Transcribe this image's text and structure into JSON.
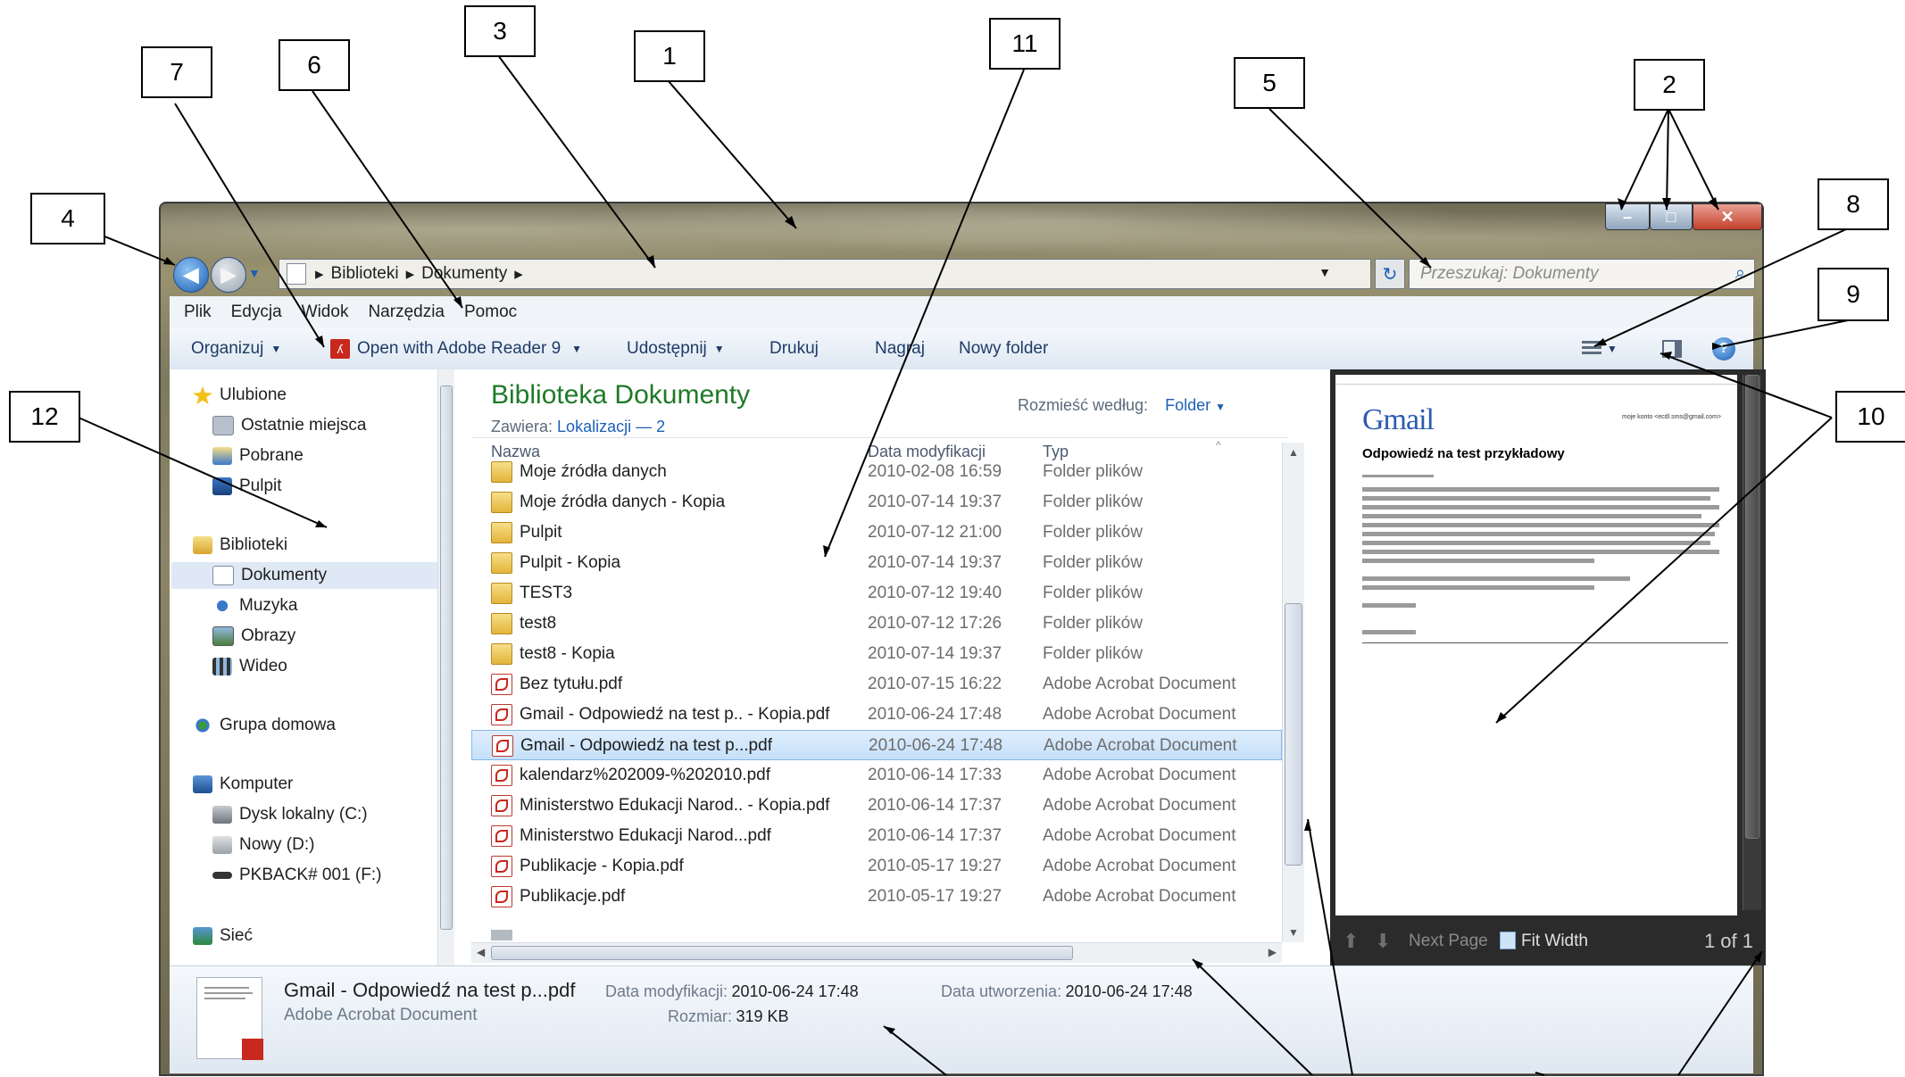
{
  "nav": {
    "breadcrumb": [
      "Biblioteki",
      "Dokumenty"
    ],
    "search_placeholder": "Przeszukaj: Dokumenty"
  },
  "menu": [
    "Plik",
    "Edycja",
    "Widok",
    "Narzędzia",
    "Pomoc"
  ],
  "toolbar": {
    "organize": "Organizuj",
    "open_with": "Open with Adobe Reader 9",
    "share": "Udostępnij",
    "print": "Drukuj",
    "burn": "Nagraj",
    "new_folder": "Nowy folder"
  },
  "sidebar": {
    "favorites": "Ulubione",
    "recent": "Ostatnie miejsca",
    "downloads": "Pobrane",
    "desktop": "Pulpit",
    "libraries": "Biblioteki",
    "documents": "Dokumenty",
    "music": "Muzyka",
    "pictures": "Obrazy",
    "video": "Wideo",
    "homegroup": "Grupa domowa",
    "computer": "Komputer",
    "drive_c": "Dysk lokalny (C:)",
    "drive_d": "Nowy (D:)",
    "drive_f": "PKBACK# 001 (F:)",
    "network": "Sieć"
  },
  "library": {
    "title": "Biblioteka Dokumenty",
    "contains_label": "Zawiera:",
    "contains_value": "Lokalizacji — 2",
    "arrange_label": "Rozmieść według:",
    "arrange_value": "Folder"
  },
  "columns": {
    "name": "Nazwa",
    "date": "Data modyfikacji",
    "type": "Typ"
  },
  "files": [
    {
      "name": "Moje źródła danych",
      "date": "2010-02-08 16:59",
      "type": "Folder plików",
      "icon": "special-folder-icon"
    },
    {
      "name": "Moje źródła danych - Kopia",
      "date": "2010-07-14 19:37",
      "type": "Folder plików",
      "icon": "special-folder-icon"
    },
    {
      "name": "Pulpit",
      "date": "2010-07-12 21:00",
      "type": "Folder plików",
      "icon": "folder-icon"
    },
    {
      "name": "Pulpit - Kopia",
      "date": "2010-07-14 19:37",
      "type": "Folder plików",
      "icon": "folder-icon"
    },
    {
      "name": "TEST3",
      "date": "2010-07-12 19:40",
      "type": "Folder plików",
      "icon": "folder-icon"
    },
    {
      "name": "test8",
      "date": "2010-07-12 17:26",
      "type": "Folder plików",
      "icon": "folder-icon"
    },
    {
      "name": "test8 - Kopia",
      "date": "2010-07-14 19:37",
      "type": "Folder plików",
      "icon": "folder-icon"
    },
    {
      "name": "Bez tytułu.pdf",
      "date": "2010-07-15 16:22",
      "type": "Adobe Acrobat Document",
      "icon": "pdf-icon"
    },
    {
      "name": "Gmail - Odpowiedź na test p.. - Kopia.pdf",
      "date": "2010-06-24 17:48",
      "type": "Adobe Acrobat Document",
      "icon": "pdf-icon"
    },
    {
      "name": "Gmail - Odpowiedź na test p...pdf",
      "date": "2010-06-24 17:48",
      "type": "Adobe Acrobat Document",
      "icon": "pdf-icon",
      "selected": true
    },
    {
      "name": "kalendarz%202009-%202010.pdf",
      "date": "2010-06-14 17:33",
      "type": "Adobe Acrobat Document",
      "icon": "pdf-icon"
    },
    {
      "name": "Ministerstwo Edukacji Narod.. - Kopia.pdf",
      "date": "2010-06-14 17:37",
      "type": "Adobe Acrobat Document",
      "icon": "pdf-icon"
    },
    {
      "name": "Ministerstwo Edukacji Narod...pdf",
      "date": "2010-06-14 17:37",
      "type": "Adobe Acrobat Document",
      "icon": "pdf-icon"
    },
    {
      "name": "Publikacje - Kopia.pdf",
      "date": "2010-05-17 19:27",
      "type": "Adobe Acrobat Document",
      "icon": "pdf-icon"
    },
    {
      "name": "Publikacje.pdf",
      "date": "2010-05-17 19:27",
      "type": "Adobe Acrobat Document",
      "icon": "pdf-icon"
    }
  ],
  "preview": {
    "gmail_logo": "Gmail",
    "user_email": "moje konto <ecdl.sms@gmail.com>",
    "subject": "Odpowiedź na test przykładowy",
    "next_page": "Next Page",
    "fit_width": "Fit Width",
    "page_count": "1 of 1"
  },
  "details": {
    "filename": "Gmail - Odpowiedź na test p...pdf",
    "type": "Adobe Acrobat Document",
    "modified_label": "Data modyfikacji:",
    "modified_value": "2010-06-24 17:48",
    "created_label": "Data utworzenia:",
    "created_value": "2010-06-24 17:48",
    "size_label": "Rozmiar:",
    "size_value": "319 KB"
  },
  "annotations": [
    "1",
    "2",
    "3",
    "4",
    "5",
    "6",
    "7",
    "8",
    "9",
    "10",
    "11",
    "12"
  ]
}
